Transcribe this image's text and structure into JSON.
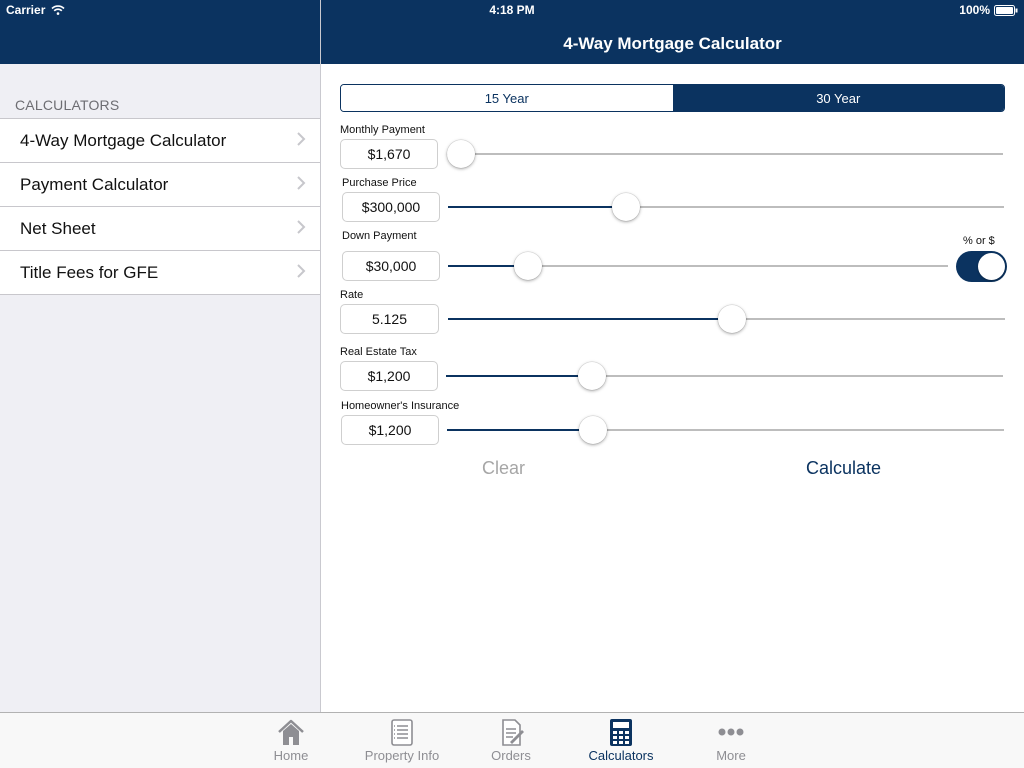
{
  "status_bar": {
    "carrier": "Carrier",
    "time": "4:18 PM",
    "battery": "100%"
  },
  "nav": {
    "title": "4-Way Mortgage Calculator"
  },
  "sidebar": {
    "section_header": "CALCULATORS",
    "items": [
      {
        "label": "4-Way Mortgage Calculator"
      },
      {
        "label": "Payment Calculator"
      },
      {
        "label": "Net Sheet"
      },
      {
        "label": "Title Fees for GFE"
      }
    ]
  },
  "term_segment": {
    "options": [
      "15 Year",
      "30 Year"
    ],
    "selected": "30 Year"
  },
  "fields": {
    "monthly_payment": {
      "label": "Monthly Payment",
      "value": "$1,670",
      "slider_level": 0.0
    },
    "purchase_price": {
      "label": "Purchase Price",
      "value": "$300,000",
      "slider_level": 0.31
    },
    "down_payment": {
      "label": "Down Payment",
      "value": "$30,000",
      "slider_level": 0.14,
      "toggle_label": "% or $",
      "toggle_on": true
    },
    "rate": {
      "label": "Rate",
      "value": "5.125",
      "slider_level": 0.51
    },
    "real_estate_tax": {
      "label": "Real Estate Tax",
      "value": "$1,200",
      "slider_level": 0.25
    },
    "homeowners_insurance": {
      "label": "Homeowner's Insurance",
      "value": "$1,200",
      "slider_level": 0.25
    }
  },
  "actions": {
    "clear": "Clear",
    "calculate": "Calculate"
  },
  "tabs": [
    {
      "label": "Home",
      "icon": "home-icon",
      "active": false
    },
    {
      "label": "Property Info",
      "icon": "clipboard-list-icon",
      "active": false
    },
    {
      "label": "Orders",
      "icon": "document-pen-icon",
      "active": false
    },
    {
      "label": "Calculators",
      "icon": "calculator-icon",
      "active": true
    },
    {
      "label": "More",
      "icon": "more-dots-icon",
      "active": false
    }
  ],
  "colors": {
    "brand": "#0b3360",
    "sidebar_bg": "#efeff4",
    "inactive_tab": "#8e8e93"
  }
}
